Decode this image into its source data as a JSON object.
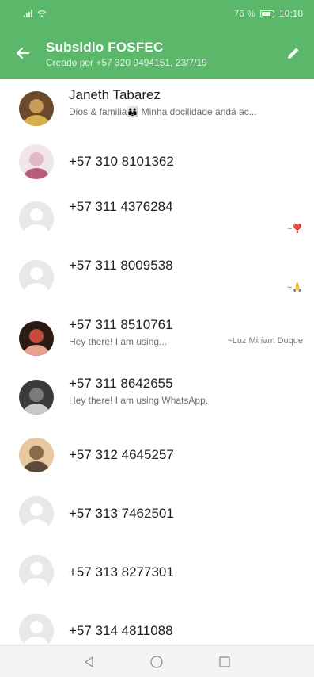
{
  "status_bar": {
    "battery_text": "76 %",
    "time": "10:18",
    "icons": [
      "signal-icon",
      "wifi-icon",
      "battery-icon"
    ]
  },
  "header": {
    "title": "Subsidio FOSFEC",
    "subtitle": "Creado por +57 320 9494151, 23/7/19",
    "icons": [
      "back-arrow-icon",
      "pencil-icon"
    ]
  },
  "contacts": [
    {
      "name": "Janeth Tabarez",
      "about": "Dios & familia👪 Minha docilidade andá ac...",
      "aside": "",
      "avatar": "photo"
    },
    {
      "name": "+57 310 8101362",
      "about": "",
      "aside": "",
      "avatar": "photo"
    },
    {
      "name": "+57 311 4376284",
      "about": "",
      "aside": "~❣️",
      "avatar": "default"
    },
    {
      "name": "+57 311 8009538",
      "about": "",
      "aside": "~🙏",
      "avatar": "default"
    },
    {
      "name": "+57 311 8510761",
      "about": "Hey there! I am using...",
      "aside": "~Luz Miriam Duque",
      "avatar": "photo"
    },
    {
      "name": "+57 311 8642655",
      "about": "Hey there! I am using WhatsApp.",
      "aside": "",
      "avatar": "photo"
    },
    {
      "name": "+57 312 4645257",
      "about": "",
      "aside": "",
      "avatar": "photo"
    },
    {
      "name": "+57 313 7462501",
      "about": "",
      "aside": "",
      "avatar": "default"
    },
    {
      "name": "+57 313 8277301",
      "about": "",
      "aside": "",
      "avatar": "default"
    },
    {
      "name": "+57 314 4811088",
      "about": "",
      "aside": "",
      "avatar": "default"
    }
  ],
  "nav_bar": {
    "icons": [
      "back-triangle-icon",
      "home-circle-icon",
      "recents-square-icon"
    ]
  },
  "colors": {
    "header_green": "#5bb86a",
    "default_avatar_bg": "#e6e8ea",
    "default_avatar_fg": "#ffffff"
  }
}
